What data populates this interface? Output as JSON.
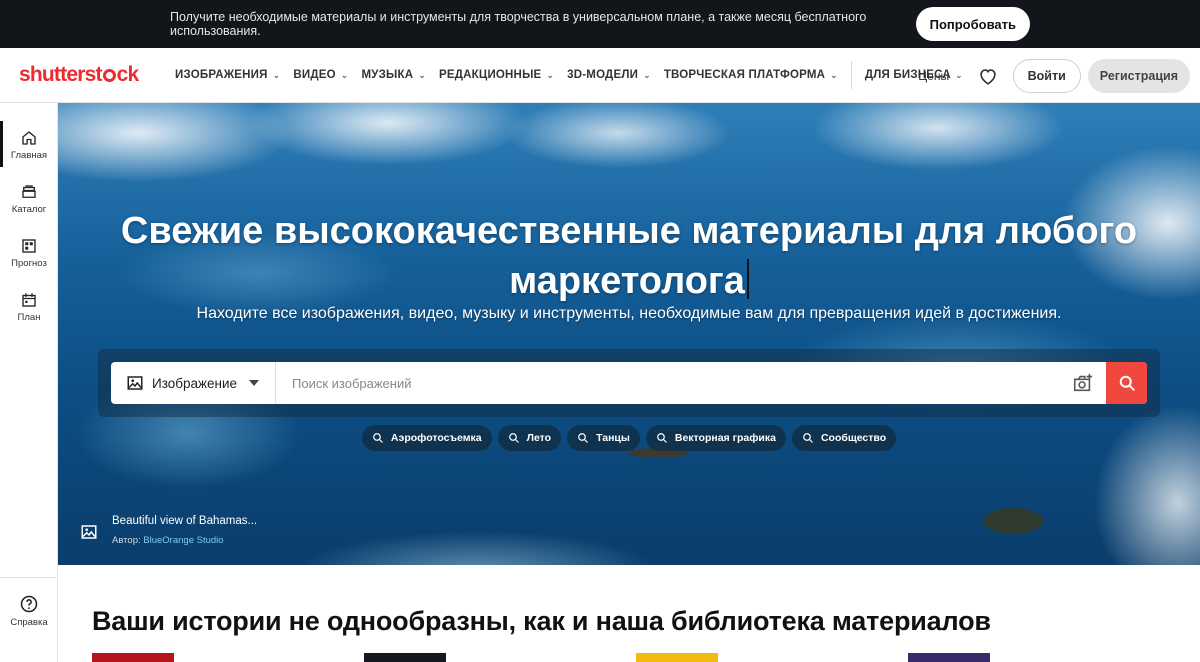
{
  "promo": {
    "text": "Получите необходимые материалы и инструменты для творчества в универсальном плане, а также месяц бесплатного использования.",
    "button": "Попробовать"
  },
  "header": {
    "logo": {
      "part1": "shutterst",
      "part2": "ck"
    },
    "nav": [
      {
        "label": "ИЗОБРАЖЕНИЯ",
        "has_dropdown": true
      },
      {
        "label": "ВИДЕО",
        "has_dropdown": true
      },
      {
        "label": "МУЗЫКА",
        "has_dropdown": true
      },
      {
        "label": "РЕДАКЦИОННЫЕ",
        "has_dropdown": true
      },
      {
        "label": "3D-МОДЕЛИ",
        "has_dropdown": true
      },
      {
        "label": "ТВОРЧЕСКАЯ ПЛАТФОРМА",
        "has_dropdown": true
      }
    ],
    "business": "ДЛЯ БИЗНЕСА",
    "prices": "Цены",
    "login": "Войти",
    "register": "Регистрация"
  },
  "sidebar": {
    "items": [
      {
        "label": "Главная",
        "icon": "home-icon",
        "active": true
      },
      {
        "label": "Каталог",
        "icon": "catalog-icon"
      },
      {
        "label": "Прогноз",
        "icon": "forecast-icon"
      },
      {
        "label": "План",
        "icon": "plan-icon"
      }
    ],
    "help": "Справка"
  },
  "hero": {
    "title_line1": "Свежие высококачественные материалы для любого",
    "title_line2": "маркетолога",
    "subtitle": "Находите все изображения, видео, музыку и инструменты, необходимые вам для превращения идей в достижения.",
    "search": {
      "type": "Изображение",
      "placeholder": "Поиск изображений"
    },
    "chips": [
      "Аэрофотосъемка",
      "Лето",
      "Танцы",
      "Векторная графика",
      "Сообщество"
    ],
    "credit": {
      "title": "Beautiful view of Bahamas...",
      "author_prefix": "Автор:",
      "author": "BlueOrange Studio"
    }
  },
  "section": {
    "title": "Ваши истории не однообразны, как и наша библиотека материалов"
  },
  "colors": {
    "brand": "#ec2a30",
    "search_button": "#f0483e",
    "promo_bg": "#12151a"
  }
}
